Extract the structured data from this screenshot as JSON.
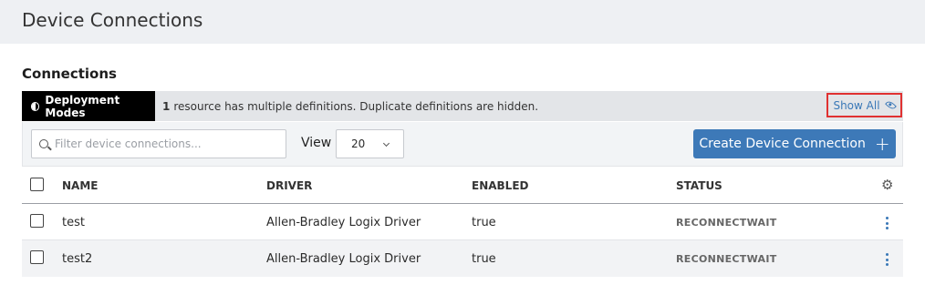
{
  "page": {
    "title": "Device Connections"
  },
  "section": {
    "title": "Connections"
  },
  "deployment": {
    "badge_label": "Deployment Modes",
    "count": "1",
    "message": "resource has multiple definitions. Duplicate definitions are hidden.",
    "show_all_label": "Show All"
  },
  "toolbar": {
    "search_placeholder": "Filter device connections...",
    "view_label": "View",
    "view_value": "20",
    "create_label": "Create Device Connection",
    "create_icon": "+"
  },
  "table": {
    "headers": {
      "name": "NAME",
      "driver": "DRIVER",
      "enabled": "ENABLED",
      "status": "STATUS"
    },
    "rows": [
      {
        "name": "test",
        "driver": "Allen-Bradley Logix Driver",
        "enabled": "true",
        "status": "RECONNECTWAIT"
      },
      {
        "name": "test2",
        "driver": "Allen-Bradley Logix Driver",
        "enabled": "true",
        "status": "RECONNECTWAIT"
      }
    ]
  },
  "icons": {
    "deployment": "half-circle-icon",
    "show_all": "eye-icon",
    "search": "search-icon",
    "view": "chevron-down-icon",
    "settings": "gear-icon",
    "row_menu": "kebab-menu-icon"
  },
  "colors": {
    "accent": "#3d79b8",
    "highlight_border": "#e03131",
    "badge_bg": "#000000"
  }
}
